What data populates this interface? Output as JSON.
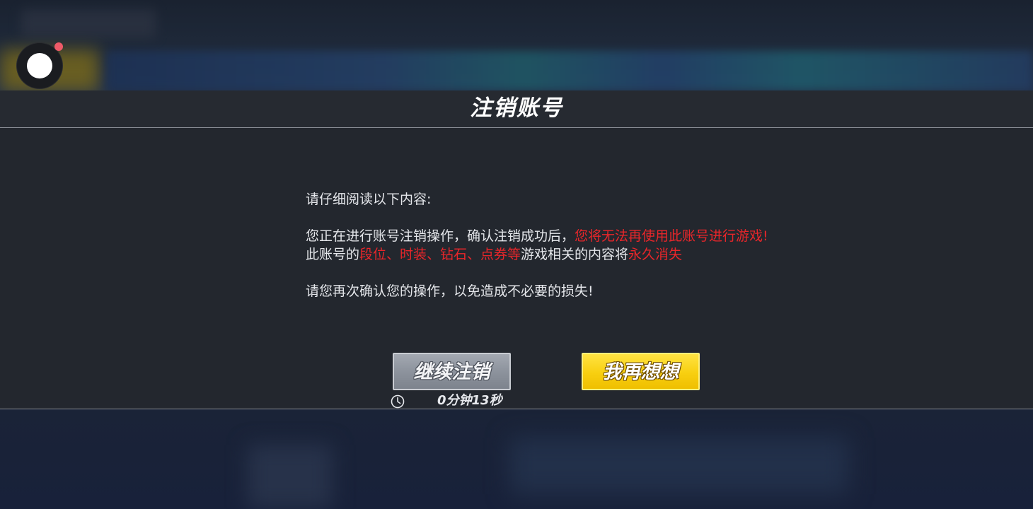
{
  "dialog": {
    "title": "注销账号",
    "intro": "请仔细阅读以下内容:",
    "line1_a": "您正在进行账号注销操作，确认注销成功后，",
    "line1_warning": "您将无法再使用此账号进行游戏!",
    "line2_a": "此账号的",
    "line2_items": "段位、时装、钻石、点券等",
    "line2_b": "游戏相关的内容将",
    "line2_warning": "永久消失",
    "confirm_note": "请您再次确认您的操作，以免造成不必要的损失!"
  },
  "buttons": {
    "continue_label": "继续注销",
    "rethink_label": "我再想想"
  },
  "timer": {
    "icon": "clock-icon",
    "text": "0分钟13秒"
  },
  "overlay": {
    "record_icon": "screen-record-icon",
    "notification_color": "#ee5a68"
  },
  "colors": {
    "warning": "#e8262a",
    "primary_button": "#f8cf10",
    "secondary_button": "#8d939d"
  }
}
